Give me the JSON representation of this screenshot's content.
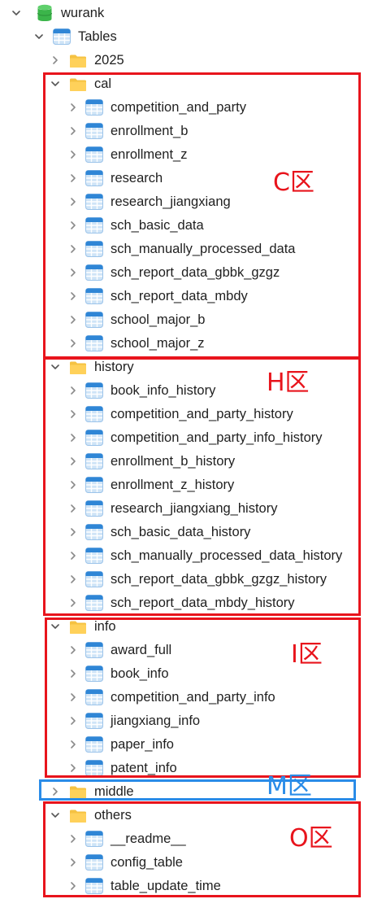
{
  "tree": {
    "database": "wurank",
    "tables_node": "Tables",
    "folders": [
      {
        "name": "2025",
        "expanded": false,
        "tables": []
      },
      {
        "name": "cal",
        "expanded": true,
        "tables": [
          "competition_and_party",
          "enrollment_b",
          "enrollment_z",
          "research",
          "research_jiangxiang",
          "sch_basic_data",
          "sch_manually_processed_data",
          "sch_report_data_gbbk_gzgz",
          "sch_report_data_mbdy",
          "school_major_b",
          "school_major_z"
        ]
      },
      {
        "name": "history",
        "expanded": true,
        "tables": [
          "book_info_history",
          "competition_and_party_history",
          "competition_and_party_info_history",
          "enrollment_b_history",
          "enrollment_z_history",
          "research_jiangxiang_history",
          "sch_basic_data_history",
          "sch_manually_processed_data_history",
          "sch_report_data_gbbk_gzgz_history",
          "sch_report_data_mbdy_history"
        ]
      },
      {
        "name": "info",
        "expanded": true,
        "tables": [
          "award_full",
          "book_info",
          "competition_and_party_info",
          "jiangxiang_info",
          "paper_info",
          "patent_info"
        ]
      },
      {
        "name": "middle",
        "expanded": false,
        "tables": []
      },
      {
        "name": "others",
        "expanded": true,
        "tables": [
          "__readme__",
          "config_table",
          "table_update_time"
        ]
      }
    ]
  },
  "zones": [
    {
      "label": "C区",
      "color": "#e8141c"
    },
    {
      "label": "H区",
      "color": "#e8141c"
    },
    {
      "label": "I区",
      "color": "#e8141c"
    },
    {
      "label": "M区",
      "color": "#2a8ce8"
    },
    {
      "label": "O区",
      "color": "#e8141c"
    }
  ],
  "icons": {
    "database": "database-icon",
    "tables": "tables-icon",
    "folder": "folder-icon",
    "table": "table-icon",
    "chevron_down": "chevron-down-icon",
    "chevron_right": "chevron-right-icon"
  },
  "colors": {
    "folder": "#f5c242",
    "table_blue": "#2f86d6",
    "database_green": "#3bb54a",
    "zone_red": "#e8141c",
    "zone_blue": "#2a8ce8"
  }
}
